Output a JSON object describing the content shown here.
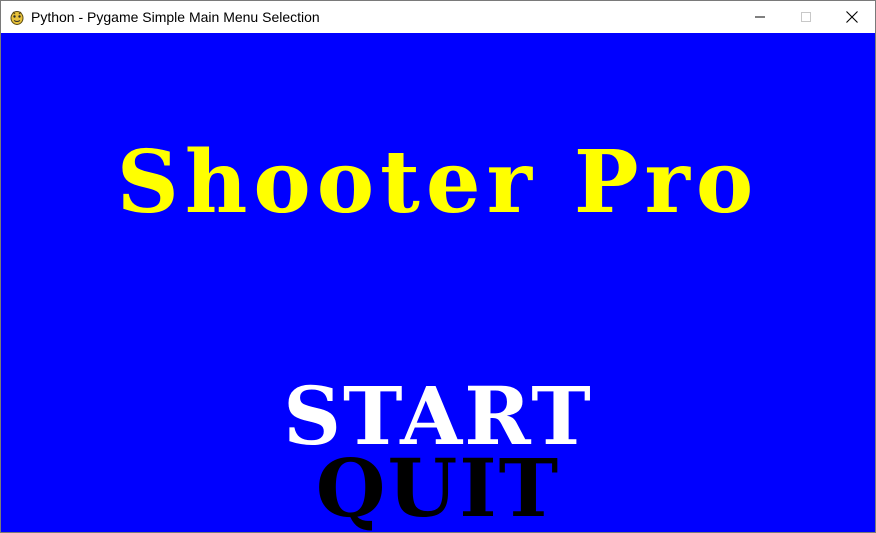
{
  "window": {
    "title": "Python - Pygame Simple Main Menu Selection",
    "icon": "pygame-snake-icon"
  },
  "caption_buttons": {
    "minimize_icon": "minimize-icon",
    "maximize_icon": "maximize-icon",
    "close_icon": "close-icon"
  },
  "game": {
    "background_color": "#0000ff",
    "title": "Shooter Pro",
    "title_color": "#ffff00",
    "menu": {
      "items": [
        {
          "label": "START",
          "color": "#ffffff",
          "selected": true
        },
        {
          "label": "QUIT",
          "color": "#000000",
          "selected": false
        }
      ]
    }
  }
}
